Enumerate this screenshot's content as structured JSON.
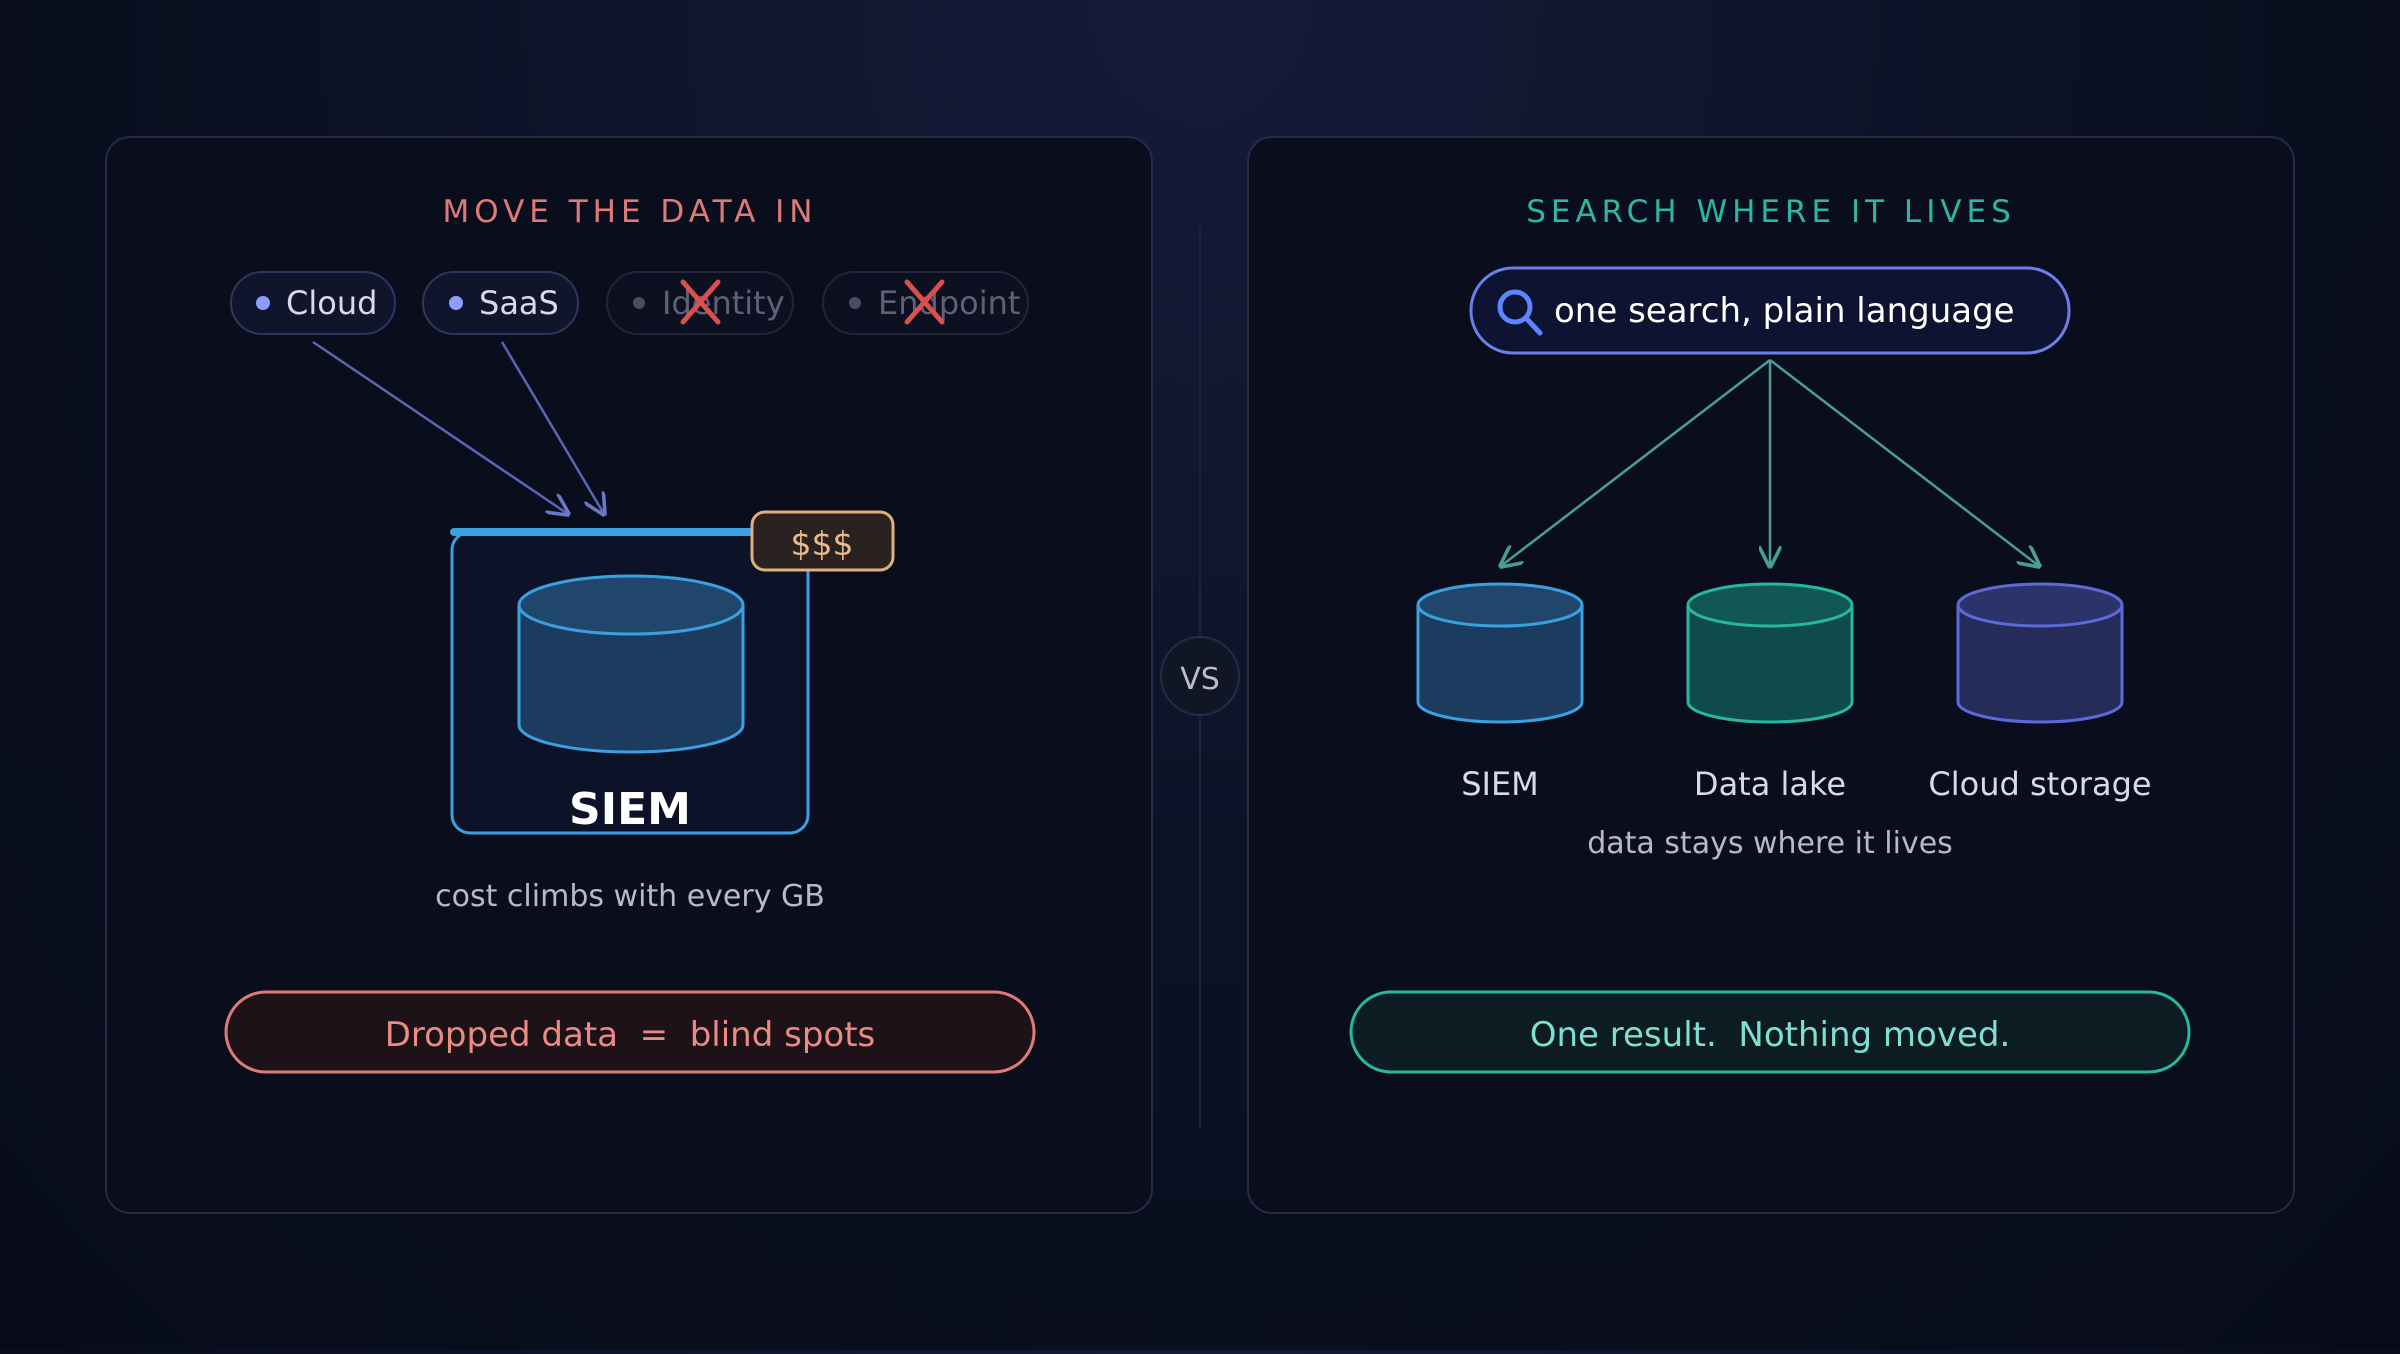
{
  "colors": {
    "panel_bg": "#0a0e1c",
    "panel_border": "#262c45",
    "left_accent": "#e07a78",
    "right_accent": "#2bb6a6",
    "source_dot": "#8d9dff",
    "source_text": "#d7dbe8",
    "source_faded_text": "#5e6274",
    "cross": "#d9504c",
    "flow_arrow": "#5866b8",
    "siem_blue": "#3ba0e0",
    "siem_fill": "#1b3c5e",
    "cost_tag_border": "#e0b07a",
    "cost_tag_text": "#e8b98a",
    "teal": "#27b6a0",
    "teal_fill": "#0f4b4a",
    "indigo": "#5b6ad8",
    "indigo_fill": "#252c5a",
    "search_border": "#6b7fe8",
    "search_icon": "#5b86ff",
    "connector": "#4a9d95"
  },
  "left_panel": {
    "title": "MOVE THE DATA IN",
    "sources": [
      {
        "label": "Cloud",
        "status": "active"
      },
      {
        "label": "SaaS",
        "status": "active"
      },
      {
        "label": "Identity",
        "status": "dropped"
      },
      {
        "label": "Endpoint",
        "status": "dropped"
      }
    ],
    "siem_label": "SIEM",
    "cost_tag": "$$$",
    "cost_note": "cost climbs with every GB",
    "callout": "Dropped data  =  blind spots"
  },
  "divider": {
    "label": "VS"
  },
  "right_panel": {
    "title": "SEARCH WHERE IT LIVES",
    "search_text": "one search, plain language",
    "stores": [
      {
        "label": "SIEM",
        "kind": "siem"
      },
      {
        "label": "Data lake",
        "kind": "lake"
      },
      {
        "label": "Cloud storage",
        "kind": "cloud"
      }
    ],
    "stays_note": "data stays where it lives",
    "callout": "One result.  Nothing moved."
  }
}
